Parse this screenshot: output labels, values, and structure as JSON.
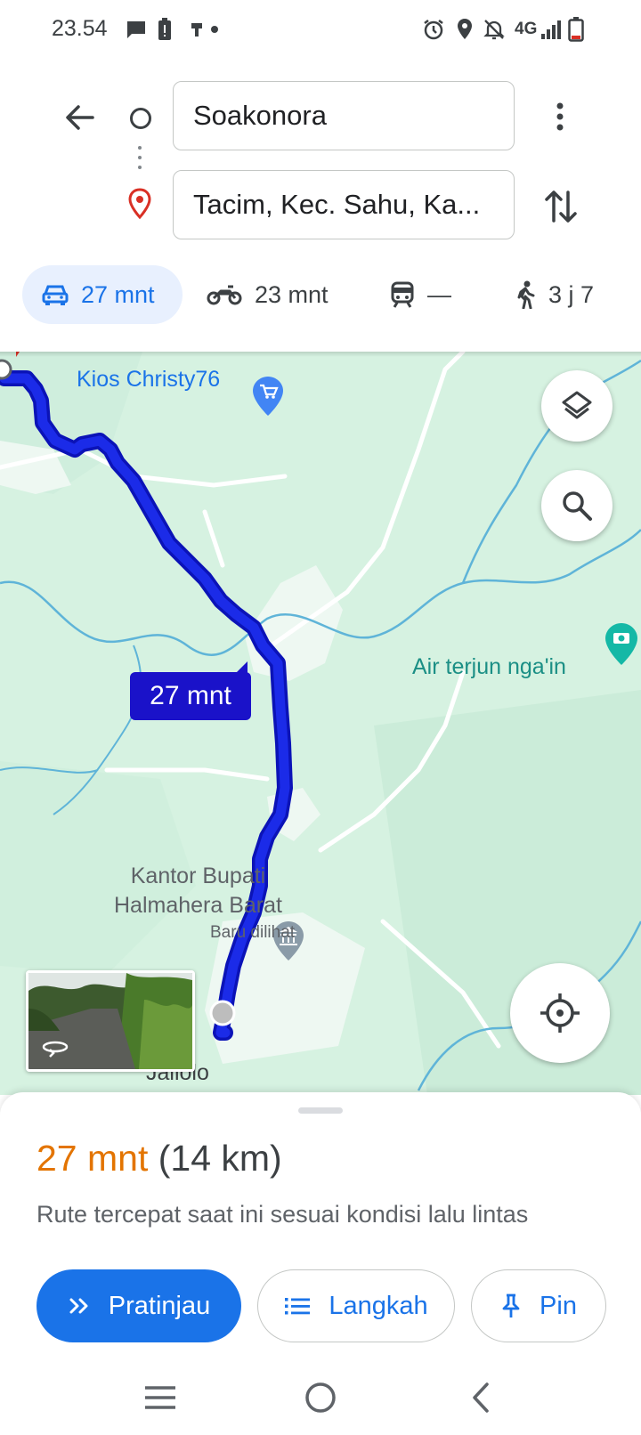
{
  "status_bar": {
    "time": "23.54",
    "network": "4G",
    "icons": [
      "message-icon",
      "battery-alert-icon",
      "usb-icon",
      "dot-icon",
      "alarm-icon",
      "location-icon",
      "mute-icon",
      "signal-icon",
      "battery-icon"
    ]
  },
  "directions": {
    "origin": "Soakonora",
    "destination": "Tacim, Kec. Sahu, Ka..."
  },
  "modes": [
    {
      "icon": "car-icon",
      "label": "27 mnt",
      "selected": true
    },
    {
      "icon": "motorcycle-icon",
      "label": "23 mnt",
      "selected": false
    },
    {
      "icon": "train-icon",
      "label": "—",
      "selected": false
    },
    {
      "icon": "walk-icon",
      "label": "3 j 7",
      "selected": false
    }
  ],
  "map": {
    "route_time": "27 mnt",
    "places": {
      "kios": "Kios Christy76",
      "air": "Air terjun nga'in",
      "kantor_line1": "Kantor Bupati",
      "kantor_line2": "Halmahera Barat",
      "kantor_status": "Baru dilihat",
      "town": "Jailolo"
    },
    "colors": {
      "route": "#1b2be8",
      "land": "#d6f2e1",
      "water": "#5fb4d8"
    }
  },
  "sheet": {
    "duration": "27 mnt",
    "distance": "(14 km)",
    "note": "Rute tercepat saat ini sesuai kondisi lalu lintas",
    "buttons": {
      "preview": "Pratinjau",
      "steps": "Langkah",
      "pin": "Pin"
    }
  },
  "accent_color": "#1a73e8",
  "duration_color": "#e37400"
}
